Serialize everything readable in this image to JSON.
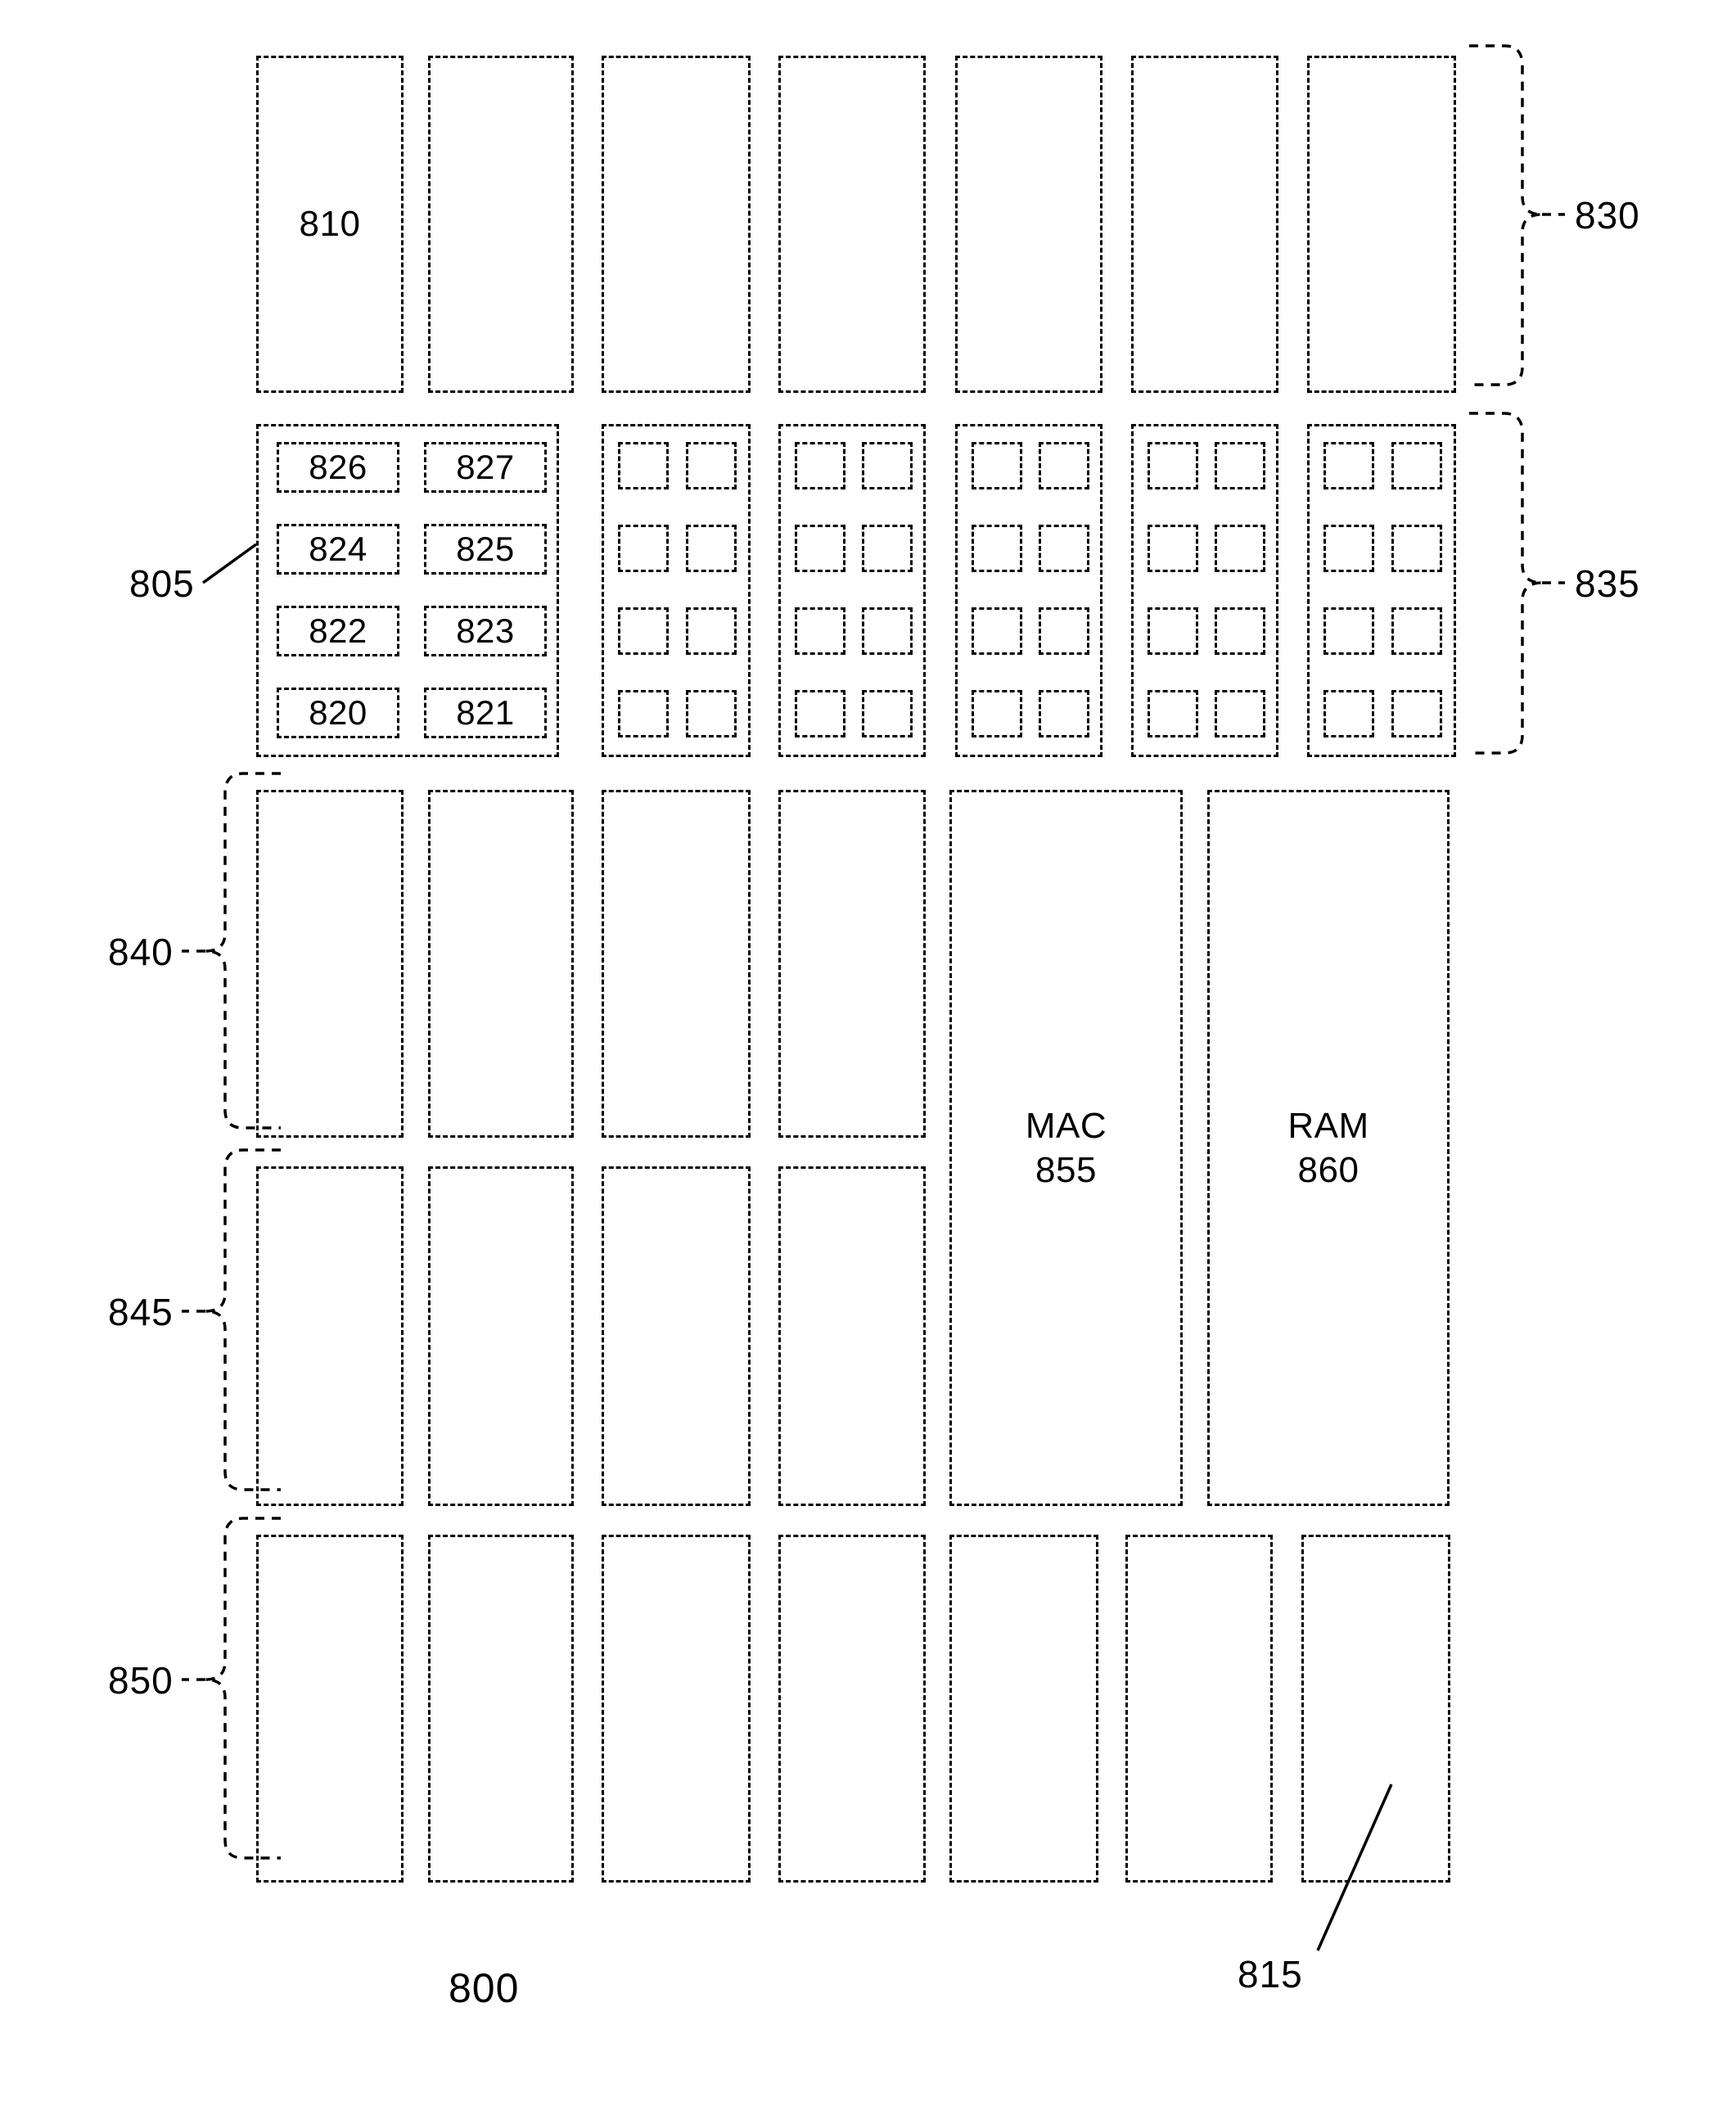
{
  "figure": {
    "figure_number": "800",
    "line_style": "dashed",
    "stroke_color": "#000000",
    "background_color": "#ffffff"
  },
  "reference_labels": {
    "figure": "800",
    "subblock_group": "805",
    "column_block": "810",
    "bottom_block": "815",
    "row_830": "830",
    "row_835": "835",
    "row_840": "840",
    "row_845": "845",
    "row_850": "850"
  },
  "rows": [
    {
      "id": "row-830",
      "bracket_label": "830",
      "bracket_side": "right",
      "column_count": 7,
      "blocks": [
        {
          "label": "810"
        },
        {
          "label": ""
        },
        {
          "label": ""
        },
        {
          "label": ""
        },
        {
          "label": ""
        },
        {
          "label": ""
        },
        {
          "label": ""
        }
      ]
    },
    {
      "id": "row-835",
      "bracket_label": "835",
      "bracket_side": "right",
      "column_count": 7,
      "detail_label": "805",
      "detail_column_index": 0,
      "subcells": [
        "826",
        "827",
        "824",
        "825",
        "822",
        "823",
        "820",
        "821"
      ],
      "subcell_rows": 4,
      "subcell_cols": 2,
      "empty_grid_rows": 4,
      "empty_grid_cols": 2,
      "empty_grid_columns": 5
    },
    {
      "id": "row-840",
      "bracket_label": "840",
      "bracket_side": "left",
      "column_count": 4,
      "blocks": [
        {
          "label": ""
        },
        {
          "label": ""
        },
        {
          "label": ""
        },
        {
          "label": ""
        }
      ]
    },
    {
      "id": "row-845",
      "bracket_label": "845",
      "bracket_side": "left",
      "column_count": 4,
      "blocks": [
        {
          "label": ""
        },
        {
          "label": ""
        },
        {
          "label": ""
        },
        {
          "label": ""
        }
      ]
    },
    {
      "id": "row-850",
      "bracket_label": "850",
      "bracket_side": "left",
      "column_count": 7,
      "blocks": [
        {
          "label": ""
        },
        {
          "label": ""
        },
        {
          "label": ""
        },
        {
          "label": ""
        },
        {
          "label": ""
        },
        {
          "label": ""
        },
        {
          "label": ""
        }
      ]
    }
  ],
  "tall_blocks": [
    {
      "name": "mac",
      "title": "MAC",
      "ref": "855",
      "text": "MAC\n855"
    },
    {
      "name": "ram",
      "title": "RAM",
      "ref": "860",
      "text": "RAM\n860"
    }
  ],
  "subcells_grid": [
    [
      "826",
      "827"
    ],
    [
      "824",
      "825"
    ],
    [
      "822",
      "823"
    ],
    [
      "820",
      "821"
    ]
  ]
}
